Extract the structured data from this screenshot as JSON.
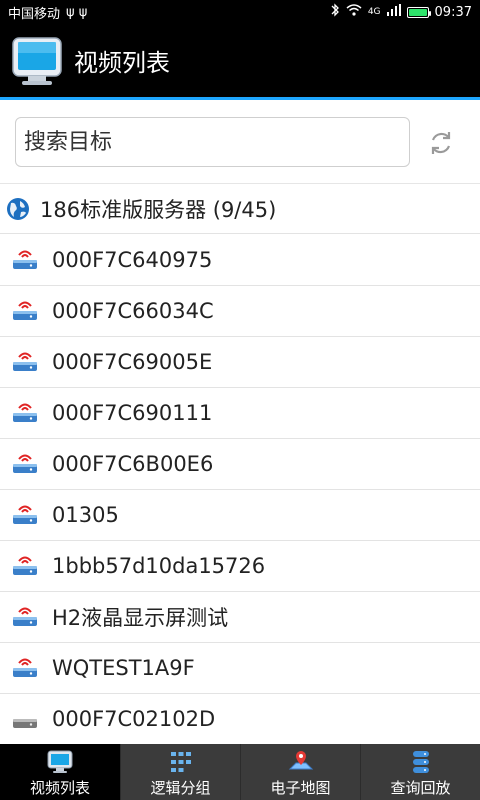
{
  "status": {
    "carrier": "中国移动",
    "usb_icons": "ψ ψ",
    "network": "4G",
    "time": "09:37",
    "battery_color": "#2ee36b"
  },
  "header": {
    "title": "视频列表",
    "accent": "#1ea7ff"
  },
  "search": {
    "placeholder": "搜索目标"
  },
  "server": {
    "label": "186标准版服务器 (9/45)"
  },
  "devices": [
    {
      "label": "000F7C640975",
      "online": true
    },
    {
      "label": "000F7C66034C",
      "online": true
    },
    {
      "label": "000F7C69005E",
      "online": true
    },
    {
      "label": "000F7C690111",
      "online": true
    },
    {
      "label": "000F7C6B00E6",
      "online": true
    },
    {
      "label": "01305",
      "online": true
    },
    {
      "label": "1bbb57d10da15726",
      "online": true
    },
    {
      "label": "H2液晶显示屏测试",
      "online": true
    },
    {
      "label": "WQTEST1A9F",
      "online": true
    },
    {
      "label": "000F7C02102D",
      "online": false
    }
  ],
  "tabs": [
    {
      "label": "视频列表",
      "icon": "monitor-icon",
      "active": true
    },
    {
      "label": "逻辑分组",
      "icon": "group-icon",
      "active": false
    },
    {
      "label": "电子地图",
      "icon": "map-icon",
      "active": false
    },
    {
      "label": "查询回放",
      "icon": "database-icon",
      "active": false
    }
  ]
}
